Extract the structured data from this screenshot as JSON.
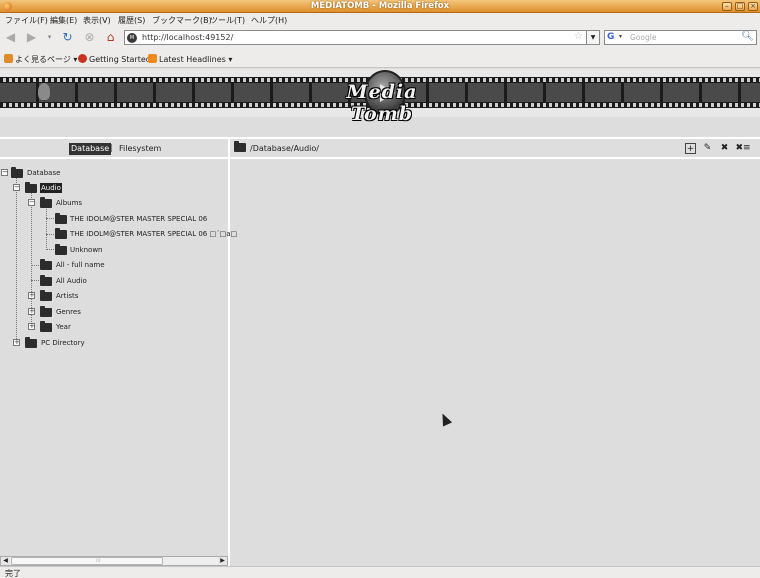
{
  "window": {
    "title": "MEDIATOMB - Mozilla Firefox"
  },
  "menu": [
    "ファイル(F)",
    "編集(E)",
    "表示(V)",
    "履歴(S)",
    "ブックマーク(B)",
    "ツール(T)",
    "ヘルプ(H)"
  ],
  "nav": {
    "url": "http://localhost:49152/",
    "search_placeholder": "Google"
  },
  "bookmarks": [
    "よく見るページ",
    "Getting Started",
    "Latest Headlines"
  ],
  "logo": {
    "text": "Media Tomb"
  },
  "tabs": {
    "database": "Database",
    "separator": "|",
    "filesystem": "Filesystem"
  },
  "path": "/Database/Audio/",
  "tree": {
    "root": "Database",
    "audio": "Audio",
    "albums": "Albums",
    "album1": "THE IDOLM@STER MASTER SPECIAL 06",
    "album2": "THE IDOLM@STER MASTER SPECIAL 06 □´□a□",
    "unknown": "Unknown",
    "all_full_name": "All - full name",
    "all_audio": "All Audio",
    "artists": "Artists",
    "genres": "Genres",
    "year": "Year",
    "pc_directory": "PC Directory"
  },
  "status": "完了"
}
